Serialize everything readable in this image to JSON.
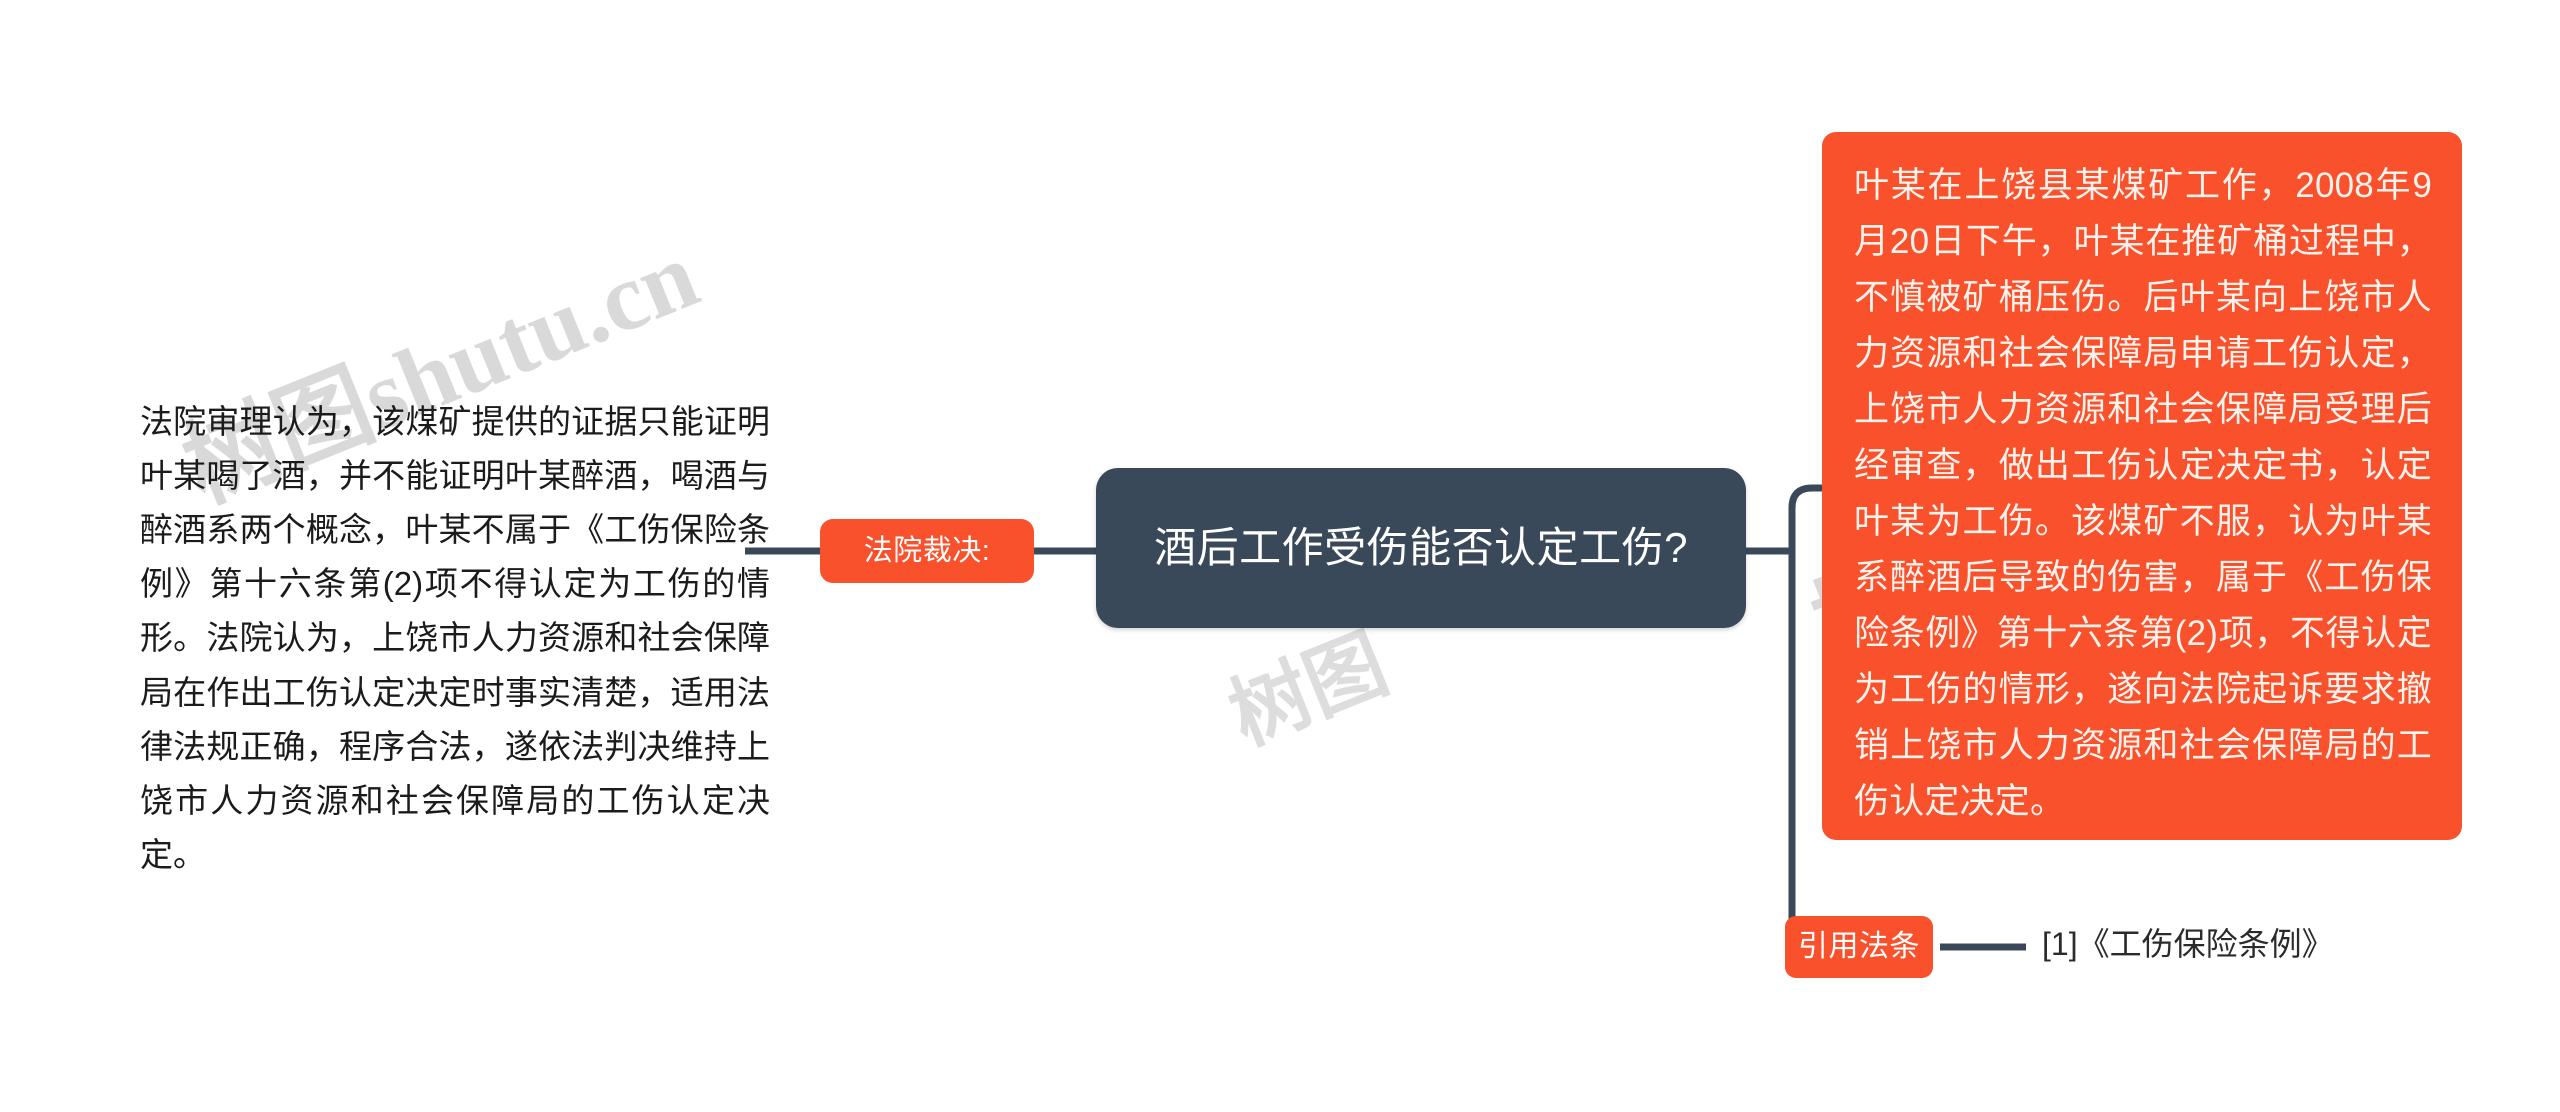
{
  "diagram": {
    "type": "mindmap",
    "watermark": {
      "primary": "树图shutu.cn",
      "secondary": "树图",
      "tertiary": "树图"
    },
    "colors": {
      "center_node_bg": "#39495a",
      "accent_orange": "#f8512c",
      "connector": "#39495a",
      "page_bg": "#ffffff",
      "body_text": "#1b1b1b",
      "orange_box_text": "#fdf2ec"
    },
    "center": {
      "title": "酒后工作受伤能否认定工伤?"
    },
    "branches": {
      "left": {
        "node_label": "法院裁决:",
        "detail": "法院审理认为，该煤矿提供的证据只能证明叶某喝了酒，并不能证明叶某醉酒，喝酒与醉酒系两个概念，叶某不属于《工伤保险条例》第十六条第(2)项不得认定为工伤的情形。法院认为，上饶市人力资源和社会保障局在作出工伤认定决定时事实清楚，适用法律法规正确，程序合法，遂依法判决维持上饶市人力资源和社会保障局的工伤认定决定。"
      },
      "right_top": {
        "case_summary": "叶某在上饶县某煤矿工作，2008年9月20日下午，叶某在推矿桶过程中，不慎被矿桶压伤。后叶某向上饶市人力资源和社会保障局申请工伤认定，上饶市人力资源和社会保障局受理后经审查，做出工伤认定决定书，认定叶某为工伤。该煤矿不服，认为叶某系醉酒后导致的伤害，属于《工伤保险条例》第十六条第(2)项，不得认定为工伤的情形，遂向法院起诉要求撤销上饶市人力资源和社会保障局的工伤认定决定。"
      },
      "right_bottom": {
        "node_label": "引用法条",
        "reference": "[1]《工伤保险条例》"
      }
    }
  }
}
